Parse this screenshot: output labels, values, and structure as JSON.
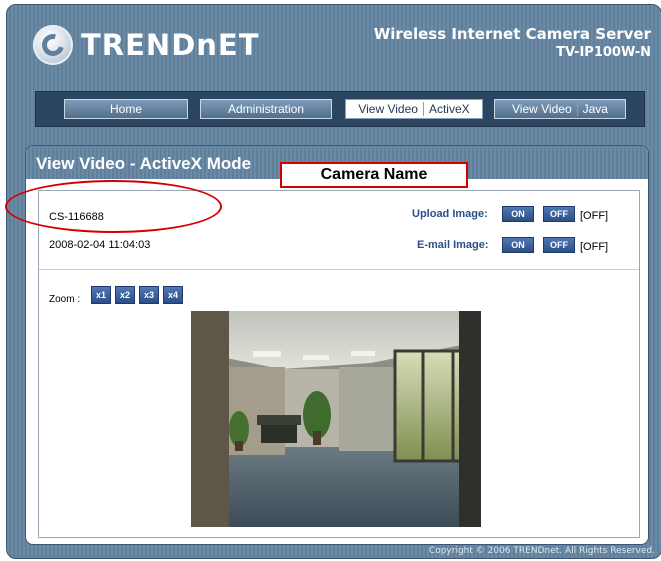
{
  "header": {
    "logo_text": "TRENDnET",
    "product_line1": "Wireless Internet Camera Server",
    "product_line2": "TV-IP100W-N"
  },
  "nav": {
    "home": "Home",
    "administration": "Administration",
    "view_video_a": "View Video",
    "activex": "ActiveX",
    "view_video_b": "View Video",
    "java": "Java"
  },
  "panel": {
    "title": "View Video - ActiveX Mode"
  },
  "status": {
    "camera_name": "CS-116688",
    "datetime": "2008-02-04 11:04:03",
    "upload_label": "Upload Image:",
    "upload_on": "ON",
    "upload_off": "OFF",
    "upload_state": "[OFF]",
    "email_label": "E-mail Image:",
    "email_on": "ON",
    "email_off": "OFF",
    "email_state": "[OFF]"
  },
  "zoom": {
    "label": "Zoom :",
    "options": [
      "x1",
      "x2",
      "x3",
      "x4"
    ]
  },
  "annotation": {
    "callout": "Camera Name"
  },
  "footer": {
    "copyright": "Copyright © 2006 TRENDnet. All Rights Reserved."
  },
  "colors": {
    "accent": "#5f7f9b",
    "nav_bg": "#2c4560",
    "annotation": "#d40000"
  }
}
